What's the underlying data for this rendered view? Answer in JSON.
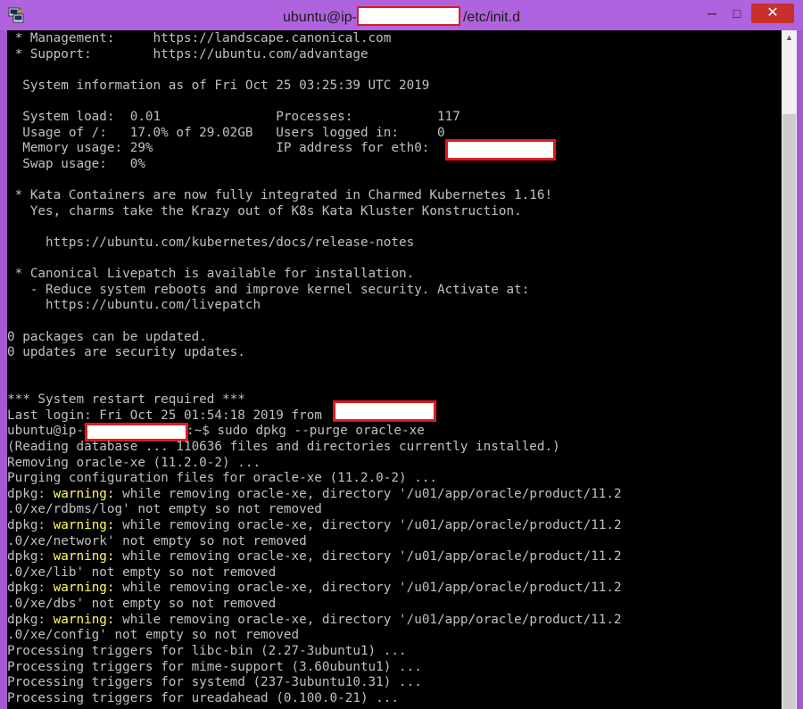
{
  "window": {
    "title_prefix": "ubuntu@ip-",
    "title_suffix": "/etc/init.d"
  },
  "terminal": {
    "lines": [
      " * Management:     https://landscape.canonical.com",
      " * Support:        https://ubuntu.com/advantage",
      "",
      "  System information as of Fri Oct 25 03:25:39 UTC 2019",
      "",
      "  System load:  0.01               Processes:           117",
      "  Usage of /:   17.0% of 29.02GB   Users logged in:     0",
      "  Memory usage: 29%                IP address for eth0:",
      "  Swap usage:   0%",
      "",
      " * Kata Containers are now fully integrated in Charmed Kubernetes 1.16!",
      "   Yes, charms take the Krazy out of K8s Kata Kluster Konstruction.",
      "",
      "     https://ubuntu.com/kubernetes/docs/release-notes",
      "",
      " * Canonical Livepatch is available for installation.",
      "   - Reduce system reboots and improve kernel security. Activate at:",
      "     https://ubuntu.com/livepatch",
      "",
      "0 packages can be updated.",
      "0 updates are security updates.",
      "",
      "",
      "*** System restart required ***",
      "Last login: Fri Oct 25 01:54:18 2019 from",
      "ubuntu@ip-",
      "(Reading database ... 110636 files and directories currently installed.)",
      "Removing oracle-xe (11.2.0-2) ...",
      "Purging configuration files for oracle-xe (11.2.0-2) ...",
      "dpkg: ",
      ".0/xe/rdbms/log' not empty so not removed",
      "dpkg: ",
      ".0/xe/network' not empty so not removed",
      "dpkg: ",
      ".0/xe/lib' not empty so not removed",
      "dpkg: ",
      ".0/xe/dbs' not empty so not removed",
      "dpkg: ",
      ".0/xe/config' not empty so not removed",
      "Processing triggers for libc-bin (2.27-3ubuntu1) ...",
      "Processing triggers for mime-support (3.60ubuntu1) ...",
      "Processing triggers for systemd (237-3ubuntu10.31) ...",
      "Processing triggers for ureadahead (0.100.0-21) ..."
    ],
    "prompt_suffix": ":~$ sudo dpkg --purge oracle-xe",
    "warning_word": "warning:",
    "warning_rests": [
      " while removing oracle-xe, directory '/u01/app/oracle/product/11.2",
      " while removing oracle-xe, directory '/u01/app/oracle/product/11.2",
      " while removing oracle-xe, directory '/u01/app/oracle/product/11.2",
      " while removing oracle-xe, directory '/u01/app/oracle/product/11.2",
      " while removing oracle-xe, directory '/u01/app/oracle/product/11.2"
    ]
  },
  "colors": {
    "titlebar": "#b063de",
    "terminal_bg": "#000000",
    "terminal_fg": "#c0c0c0",
    "warning": "#ffff55",
    "redaction_border": "#e0191f",
    "close_button": "#c7302b"
  },
  "icons": {
    "app": "putty-icon",
    "minimize": "minimize-icon",
    "maximize": "maximize-icon",
    "close": "close-icon"
  }
}
